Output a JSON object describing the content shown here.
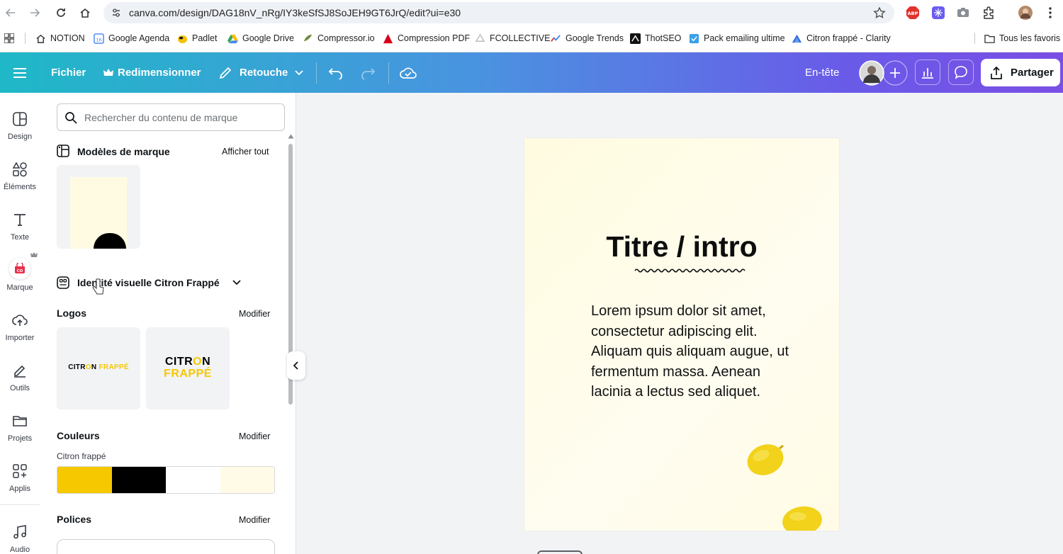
{
  "browser": {
    "url": "canva.com/design/DAG18nV_nRg/IY3keSfSJ8SoJEH9GT6JrQ/edit?ui=e30",
    "bookmarks": [
      {
        "label": "NOTION",
        "icon": "home-icon"
      },
      {
        "label": "Google Agenda",
        "icon": "calendar-icon"
      },
      {
        "label": "Padlet",
        "icon": "padlet-icon"
      },
      {
        "label": "Google Drive",
        "icon": "drive-icon"
      },
      {
        "label": "Compressor.io",
        "icon": "compressor-icon"
      },
      {
        "label": "Compression PDF",
        "icon": "pdf-icon"
      },
      {
        "label": "FCOLLECTIVE",
        "icon": "fcollective-icon"
      },
      {
        "label": "Google Trends",
        "icon": "trends-icon"
      },
      {
        "label": "ThotSEO",
        "icon": "thotseo-icon"
      },
      {
        "label": "Pack emailing ultime",
        "icon": "pack-icon"
      },
      {
        "label": "Citron frappé - Clarity",
        "icon": "clarity-icon"
      }
    ],
    "all_bookmarks": "Tous les favoris"
  },
  "header": {
    "menu_file": "Fichier",
    "resize": "Redimensionner",
    "edit_mode": "Retouche",
    "header_label": "En-tête",
    "share": "Partager"
  },
  "rail": {
    "items": [
      {
        "label": "Design",
        "icon": "design-icon"
      },
      {
        "label": "Éléments",
        "icon": "elements-icon"
      },
      {
        "label": "Texte",
        "icon": "text-icon"
      },
      {
        "label": "Marque",
        "icon": "brand-icon"
      },
      {
        "label": "Importer",
        "icon": "upload-icon"
      },
      {
        "label": "Outils",
        "icon": "tools-icon"
      },
      {
        "label": "Projets",
        "icon": "folder-icon"
      },
      {
        "label": "Applis",
        "icon": "apps-icon"
      },
      {
        "label": "Audio",
        "icon": "audio-icon"
      }
    ]
  },
  "panel": {
    "search_placeholder": "Rechercher du contenu de marque",
    "templates_title": "Modèles de marque",
    "show_all": "Afficher tout",
    "brand_kit_title": "Identité visuelle Citron Frappé",
    "logos_title": "Logos",
    "logos_modify": "Modifier",
    "logo1": {
      "text_a": "CITR",
      "text_o": "O",
      "text_b": "N",
      "text_c": "FRAPPÉ"
    },
    "logo2": {
      "line1_a": "CITR",
      "line1_o": "O",
      "line1_b": "N",
      "line2": "FRAPPÉ"
    },
    "colors_title": "Couleurs",
    "colors_modify": "Modifier",
    "palette_name": "Citron frappé",
    "palette": [
      "#f5c800",
      "#000000",
      "#ffffff",
      "#fffbe6"
    ],
    "fonts_title": "Polices",
    "fonts_modify": "Modifier"
  },
  "canvas": {
    "title": "Titre / intro",
    "body": "Lorem ipsum dolor sit amet, consectetur adipiscing elit. Aliquam quis aliquam augue, ut fermentum massa. Aenean lacinia a lectus sed aliquet."
  },
  "colors": {
    "brand_yellow": "#f5c800",
    "header_start": "#1fb8c7",
    "header_end": "#7a4fe6"
  }
}
